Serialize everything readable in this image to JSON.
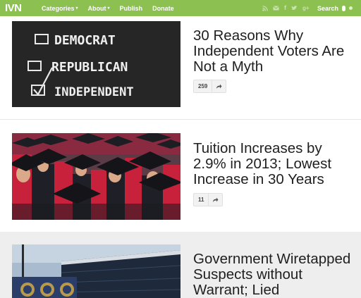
{
  "nav": {
    "logo": "IVN",
    "items": [
      {
        "label": "Categories",
        "caret": "▾"
      },
      {
        "label": "About",
        "caret": "▾"
      },
      {
        "label": "Publish",
        "caret": ""
      },
      {
        "label": "Donate",
        "caret": ""
      }
    ],
    "icons": [
      "rss-icon",
      "mail-icon",
      "facebook-icon",
      "twitter-icon",
      "google-plus-icon"
    ],
    "search_label": "Search"
  },
  "articles": [
    {
      "headline": "30 Reasons Why Independent Voters Are Not a Myth",
      "share_count": "259",
      "image_words": [
        "DEMOCRAT",
        "REPUBLICAN",
        "INDEPENDENT"
      ]
    },
    {
      "headline": "Tuition Increases by 2.9% in 2013; Lowest Increase in 30 Years",
      "share_count": "11"
    },
    {
      "headline": "Government Wiretapped Suspects without Warrant; Lied"
    }
  ],
  "colors": {
    "nav_bg": "#8cc152",
    "chalkboard": "#262626",
    "gown_red": "#b8243c"
  }
}
